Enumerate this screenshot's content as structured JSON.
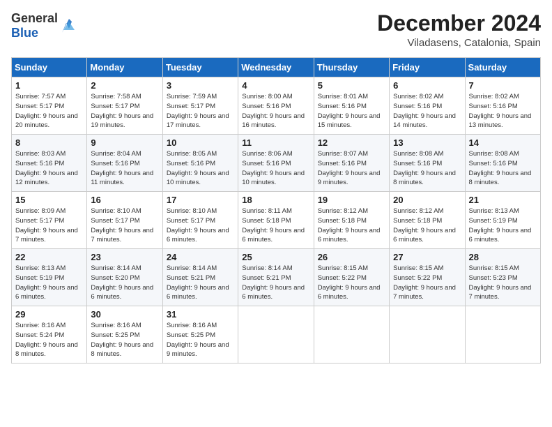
{
  "header": {
    "logo_general": "General",
    "logo_blue": "Blue",
    "month_title": "December 2024",
    "location": "Viladasens, Catalonia, Spain"
  },
  "days_of_week": [
    "Sunday",
    "Monday",
    "Tuesday",
    "Wednesday",
    "Thursday",
    "Friday",
    "Saturday"
  ],
  "weeks": [
    [
      {
        "day": "1",
        "sunrise": "7:57 AM",
        "sunset": "5:17 PM",
        "daylight": "9 hours and 20 minutes."
      },
      {
        "day": "2",
        "sunrise": "7:58 AM",
        "sunset": "5:17 PM",
        "daylight": "9 hours and 19 minutes."
      },
      {
        "day": "3",
        "sunrise": "7:59 AM",
        "sunset": "5:17 PM",
        "daylight": "9 hours and 17 minutes."
      },
      {
        "day": "4",
        "sunrise": "8:00 AM",
        "sunset": "5:16 PM",
        "daylight": "9 hours and 16 minutes."
      },
      {
        "day": "5",
        "sunrise": "8:01 AM",
        "sunset": "5:16 PM",
        "daylight": "9 hours and 15 minutes."
      },
      {
        "day": "6",
        "sunrise": "8:02 AM",
        "sunset": "5:16 PM",
        "daylight": "9 hours and 14 minutes."
      },
      {
        "day": "7",
        "sunrise": "8:02 AM",
        "sunset": "5:16 PM",
        "daylight": "9 hours and 13 minutes."
      }
    ],
    [
      {
        "day": "8",
        "sunrise": "8:03 AM",
        "sunset": "5:16 PM",
        "daylight": "9 hours and 12 minutes."
      },
      {
        "day": "9",
        "sunrise": "8:04 AM",
        "sunset": "5:16 PM",
        "daylight": "9 hours and 11 minutes."
      },
      {
        "day": "10",
        "sunrise": "8:05 AM",
        "sunset": "5:16 PM",
        "daylight": "9 hours and 10 minutes."
      },
      {
        "day": "11",
        "sunrise": "8:06 AM",
        "sunset": "5:16 PM",
        "daylight": "9 hours and 10 minutes."
      },
      {
        "day": "12",
        "sunrise": "8:07 AM",
        "sunset": "5:16 PM",
        "daylight": "9 hours and 9 minutes."
      },
      {
        "day": "13",
        "sunrise": "8:08 AM",
        "sunset": "5:16 PM",
        "daylight": "9 hours and 8 minutes."
      },
      {
        "day": "14",
        "sunrise": "8:08 AM",
        "sunset": "5:16 PM",
        "daylight": "9 hours and 8 minutes."
      }
    ],
    [
      {
        "day": "15",
        "sunrise": "8:09 AM",
        "sunset": "5:17 PM",
        "daylight": "9 hours and 7 minutes."
      },
      {
        "day": "16",
        "sunrise": "8:10 AM",
        "sunset": "5:17 PM",
        "daylight": "9 hours and 7 minutes."
      },
      {
        "day": "17",
        "sunrise": "8:10 AM",
        "sunset": "5:17 PM",
        "daylight": "9 hours and 6 minutes."
      },
      {
        "day": "18",
        "sunrise": "8:11 AM",
        "sunset": "5:18 PM",
        "daylight": "9 hours and 6 minutes."
      },
      {
        "day": "19",
        "sunrise": "8:12 AM",
        "sunset": "5:18 PM",
        "daylight": "9 hours and 6 minutes."
      },
      {
        "day": "20",
        "sunrise": "8:12 AM",
        "sunset": "5:18 PM",
        "daylight": "9 hours and 6 minutes."
      },
      {
        "day": "21",
        "sunrise": "8:13 AM",
        "sunset": "5:19 PM",
        "daylight": "9 hours and 6 minutes."
      }
    ],
    [
      {
        "day": "22",
        "sunrise": "8:13 AM",
        "sunset": "5:19 PM",
        "daylight": "9 hours and 6 minutes."
      },
      {
        "day": "23",
        "sunrise": "8:14 AM",
        "sunset": "5:20 PM",
        "daylight": "9 hours and 6 minutes."
      },
      {
        "day": "24",
        "sunrise": "8:14 AM",
        "sunset": "5:21 PM",
        "daylight": "9 hours and 6 minutes."
      },
      {
        "day": "25",
        "sunrise": "8:14 AM",
        "sunset": "5:21 PM",
        "daylight": "9 hours and 6 minutes."
      },
      {
        "day": "26",
        "sunrise": "8:15 AM",
        "sunset": "5:22 PM",
        "daylight": "9 hours and 6 minutes."
      },
      {
        "day": "27",
        "sunrise": "8:15 AM",
        "sunset": "5:22 PM",
        "daylight": "9 hours and 7 minutes."
      },
      {
        "day": "28",
        "sunrise": "8:15 AM",
        "sunset": "5:23 PM",
        "daylight": "9 hours and 7 minutes."
      }
    ],
    [
      {
        "day": "29",
        "sunrise": "8:16 AM",
        "sunset": "5:24 PM",
        "daylight": "9 hours and 8 minutes."
      },
      {
        "day": "30",
        "sunrise": "8:16 AM",
        "sunset": "5:25 PM",
        "daylight": "9 hours and 8 minutes."
      },
      {
        "day": "31",
        "sunrise": "8:16 AM",
        "sunset": "5:25 PM",
        "daylight": "9 hours and 9 minutes."
      },
      null,
      null,
      null,
      null
    ]
  ],
  "labels": {
    "sunrise": "Sunrise:",
    "sunset": "Sunset:",
    "daylight": "Daylight:"
  }
}
